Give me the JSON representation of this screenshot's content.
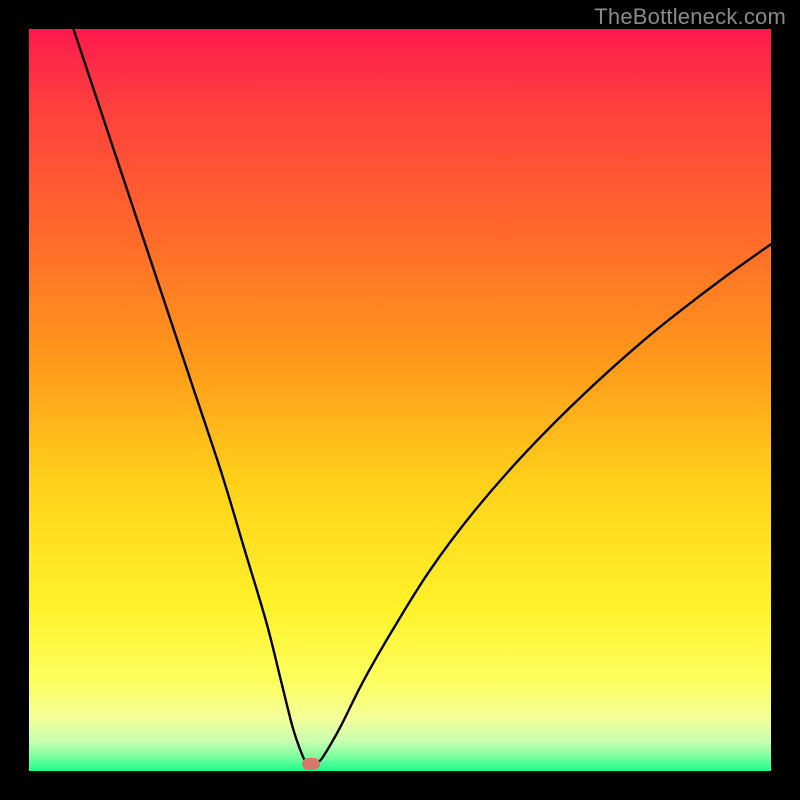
{
  "watermark": "TheBottleneck.com",
  "colors": {
    "frame": "#000000",
    "curve": "#000000",
    "marker": "#d47a6a",
    "gradient_top": "#ff1a4d",
    "gradient_bottom": "#1aff8a"
  },
  "chart_data": {
    "type": "line",
    "title": "",
    "xlabel": "",
    "ylabel": "",
    "xlim": [
      0,
      100
    ],
    "ylim": [
      0,
      100
    ],
    "annotations": [
      {
        "text": "TheBottleneck.com",
        "position": "top-right"
      }
    ],
    "marker": {
      "x": 38,
      "y": 1
    },
    "series": [
      {
        "name": "curve",
        "x": [
          6,
          10,
          14,
          18,
          22,
          26,
          29,
          32,
          34,
          35.5,
          36.5,
          37.3,
          38,
          39,
          40,
          42,
          45,
          49,
          54,
          60,
          67,
          75,
          84,
          93,
          100
        ],
        "y": [
          100,
          88,
          76,
          64,
          52,
          40,
          30,
          20,
          12,
          6,
          3,
          1.2,
          1,
          1.2,
          2.5,
          6,
          12,
          19,
          27,
          35,
          43,
          51,
          59,
          66,
          71
        ]
      }
    ]
  }
}
